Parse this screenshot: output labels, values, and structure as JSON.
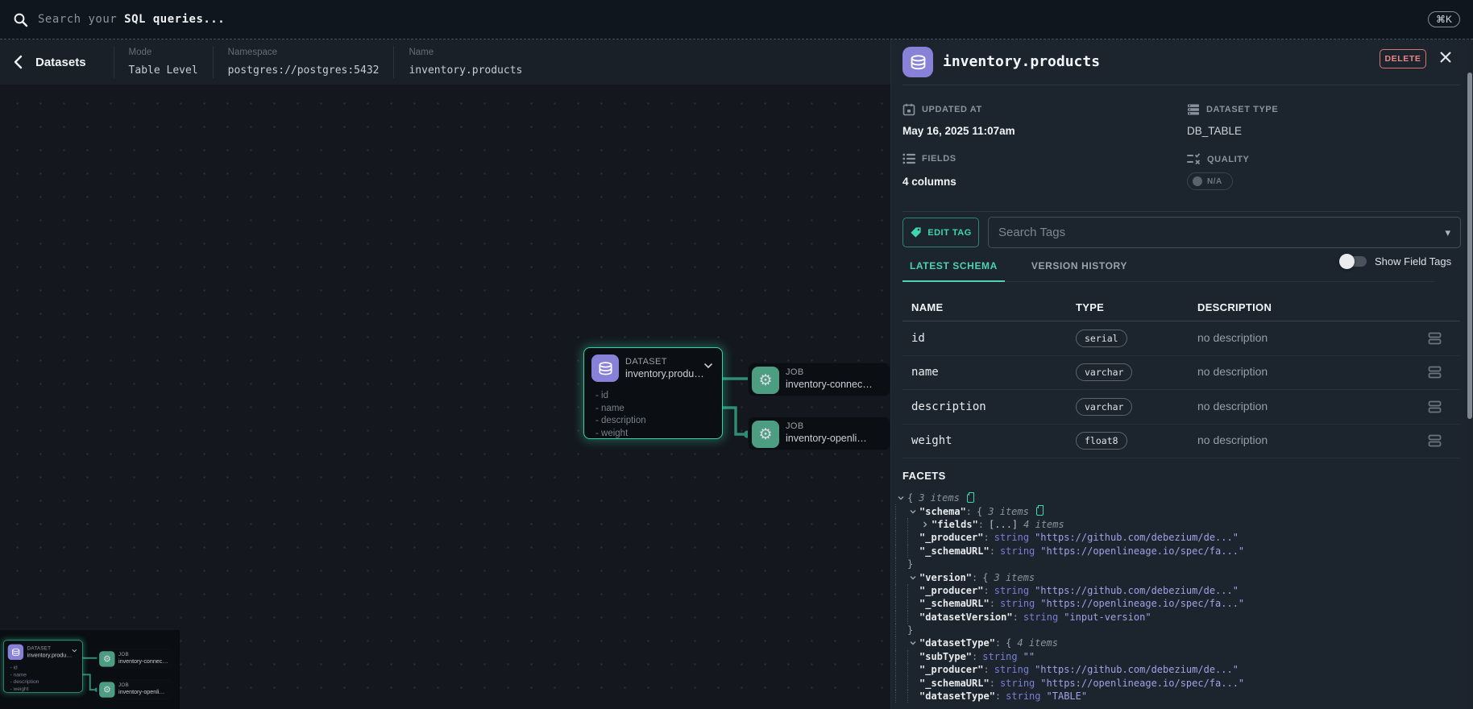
{
  "colors": {
    "accent_teal": "#3dd6ad",
    "node_purple": "#8782d8",
    "job_teal": "#4d9d82",
    "edge": "#2f8e72",
    "delete_red": "#ef8686",
    "json_type": "#7b7fd6",
    "json_string": "#9fa3e6"
  },
  "search_bar": {
    "placeholder_prefix": "Search your ",
    "placeholder_em": "SQL queries...",
    "shortcut": "⌘K"
  },
  "header": {
    "title": "Datasets",
    "meta": [
      {
        "label": "Mode",
        "value": "Table Level"
      },
      {
        "label": "Namespace",
        "value": "postgres://postgres:5432"
      },
      {
        "label": "Name",
        "value": "inventory.products"
      }
    ]
  },
  "graph": {
    "dataset": {
      "kind": "DATASET",
      "name": "inventory.produ…",
      "fields": [
        "- id",
        "- name",
        "- description",
        "- weight"
      ]
    },
    "jobs": [
      {
        "kind": "JOB",
        "name": "inventory-connec…"
      },
      {
        "kind": "JOB",
        "name": "inventory-openli…"
      }
    ]
  },
  "panel": {
    "title": "inventory.products",
    "delete_label": "DELETE",
    "meta": {
      "updated_label": "UPDATED AT",
      "updated_value": "May 16, 2025 11:07am",
      "type_label": "DATASET TYPE",
      "type_value": "DB_TABLE",
      "fields_label": "FIELDS",
      "fields_value": "4 columns",
      "quality_label": "QUALITY",
      "quality_value": "N/A"
    },
    "tags": {
      "edit_button": "EDIT TAG",
      "search_placeholder": "Search Tags"
    },
    "tabs": [
      {
        "label": "LATEST SCHEMA",
        "active": true
      },
      {
        "label": "VERSION HISTORY",
        "active": false
      }
    ],
    "show_field_tags_label": "Show Field Tags",
    "schema": {
      "columns": [
        "NAME",
        "TYPE",
        "DESCRIPTION"
      ],
      "rows": [
        {
          "name": "id",
          "type": "serial",
          "description": "no description"
        },
        {
          "name": "name",
          "type": "varchar",
          "description": "no description"
        },
        {
          "name": "description",
          "type": "varchar",
          "description": "no description"
        },
        {
          "name": "weight",
          "type": "float8",
          "description": "no description"
        }
      ]
    },
    "facets": {
      "title": "FACETS",
      "lines": [
        {
          "indent": 0,
          "segments": [
            {
              "t": "caret",
              "v": "down"
            },
            {
              "t": "brace",
              "v": "{"
            },
            {
              "t": "items",
              "v": "3 items"
            },
            {
              "t": "copy"
            }
          ]
        },
        {
          "indent": 1,
          "segments": [
            {
              "t": "caret",
              "v": "down"
            },
            {
              "t": "key",
              "v": "\"schema\""
            },
            {
              "t": "colon",
              "v": ":"
            },
            {
              "t": "brace",
              "v": "{"
            },
            {
              "t": "items",
              "v": "3 items"
            },
            {
              "t": "copy"
            }
          ]
        },
        {
          "indent": 2,
          "segments": [
            {
              "t": "caret",
              "v": "right"
            },
            {
              "t": "key",
              "v": "\"fields\""
            },
            {
              "t": "colon",
              "v": ":"
            },
            {
              "t": "ell",
              "v": "[...]"
            },
            {
              "t": "items",
              "v": "4 items"
            }
          ]
        },
        {
          "indent": 2,
          "segments": [
            {
              "t": "key",
              "v": "\"_producer\""
            },
            {
              "t": "colon",
              "v": ":"
            },
            {
              "t": "type",
              "v": "string"
            },
            {
              "t": "str",
              "v": "\"https://github.com/debezium/de...\""
            }
          ]
        },
        {
          "indent": 2,
          "segments": [
            {
              "t": "key",
              "v": "\"_schemaURL\""
            },
            {
              "t": "colon",
              "v": ":"
            },
            {
              "t": "type",
              "v": "string"
            },
            {
              "t": "str",
              "v": "\"https://openlineage.io/spec/fa...\""
            }
          ]
        },
        {
          "indent": 1,
          "segments": [
            {
              "t": "brace",
              "v": "}"
            }
          ]
        },
        {
          "indent": 1,
          "segments": [
            {
              "t": "caret",
              "v": "down"
            },
            {
              "t": "key",
              "v": "\"version\""
            },
            {
              "t": "colon",
              "v": ":"
            },
            {
              "t": "brace",
              "v": "{"
            },
            {
              "t": "items",
              "v": "3 items"
            }
          ]
        },
        {
          "indent": 2,
          "segments": [
            {
              "t": "key",
              "v": "\"_producer\""
            },
            {
              "t": "colon",
              "v": ":"
            },
            {
              "t": "type",
              "v": "string"
            },
            {
              "t": "str",
              "v": "\"https://github.com/debezium/de...\""
            }
          ]
        },
        {
          "indent": 2,
          "segments": [
            {
              "t": "key",
              "v": "\"_schemaURL\""
            },
            {
              "t": "colon",
              "v": ":"
            },
            {
              "t": "type",
              "v": "string"
            },
            {
              "t": "str",
              "v": "\"https://openlineage.io/spec/fa...\""
            }
          ]
        },
        {
          "indent": 2,
          "segments": [
            {
              "t": "key",
              "v": "\"datasetVersion\""
            },
            {
              "t": "colon",
              "v": ":"
            },
            {
              "t": "type",
              "v": "string"
            },
            {
              "t": "str",
              "v": "\"input-version\""
            }
          ]
        },
        {
          "indent": 1,
          "segments": [
            {
              "t": "brace",
              "v": "}"
            }
          ]
        },
        {
          "indent": 1,
          "segments": [
            {
              "t": "caret",
              "v": "down"
            },
            {
              "t": "key",
              "v": "\"datasetType\""
            },
            {
              "t": "colon",
              "v": ":"
            },
            {
              "t": "brace",
              "v": "{"
            },
            {
              "t": "items",
              "v": "4 items"
            }
          ]
        },
        {
          "indent": 2,
          "segments": [
            {
              "t": "key",
              "v": "\"subType\""
            },
            {
              "t": "colon",
              "v": ":"
            },
            {
              "t": "type",
              "v": "string"
            },
            {
              "t": "str",
              "v": "\"\""
            }
          ]
        },
        {
          "indent": 2,
          "segments": [
            {
              "t": "key",
              "v": "\"_producer\""
            },
            {
              "t": "colon",
              "v": ":"
            },
            {
              "t": "type",
              "v": "string"
            },
            {
              "t": "str",
              "v": "\"https://github.com/debezium/de...\""
            }
          ]
        },
        {
          "indent": 2,
          "segments": [
            {
              "t": "key",
              "v": "\"_schemaURL\""
            },
            {
              "t": "colon",
              "v": ":"
            },
            {
              "t": "type",
              "v": "string"
            },
            {
              "t": "str",
              "v": "\"https://openlineage.io/spec/fa...\""
            }
          ]
        },
        {
          "indent": 2,
          "segments": [
            {
              "t": "key",
              "v": "\"datasetType\""
            },
            {
              "t": "colon",
              "v": ":"
            },
            {
              "t": "type",
              "v": "string"
            },
            {
              "t": "str",
              "v": "\"TABLE\""
            }
          ]
        }
      ]
    }
  }
}
